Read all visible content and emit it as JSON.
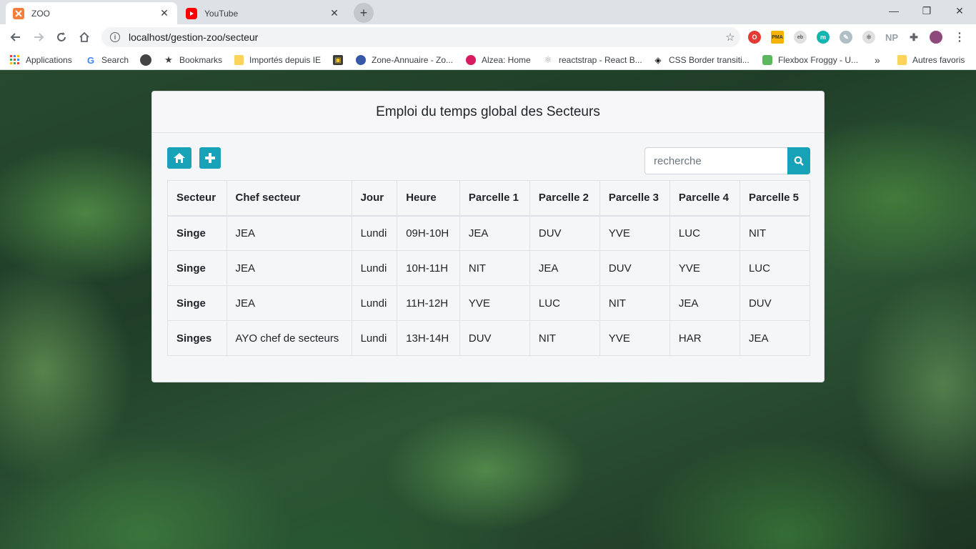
{
  "browser": {
    "tabs": [
      {
        "title": "ZOO",
        "active": true,
        "icon": "xampp-icon"
      },
      {
        "title": "YouTube",
        "active": false,
        "icon": "youtube-icon"
      }
    ],
    "url": "localhost/gestion-zoo/secteur",
    "bookmarks": [
      {
        "label": "Applications",
        "icon": "apps-grid-icon"
      },
      {
        "label": "Search",
        "icon": "google-icon"
      },
      {
        "label": "",
        "icon": "circle-icon"
      },
      {
        "label": "Bookmarks",
        "icon": "star-icon"
      },
      {
        "label": "Importés depuis IE",
        "icon": "folder-icon"
      },
      {
        "label": "",
        "icon": "game-icon"
      },
      {
        "label": "Zone-Annuaire - Zo...",
        "icon": "globe-icon"
      },
      {
        "label": "Alzea: Home",
        "icon": "alzea-icon"
      },
      {
        "label": "reactstrap - React B...",
        "icon": "react-icon"
      },
      {
        "label": "CSS Border transiti...",
        "icon": "codepen-icon"
      },
      {
        "label": "Flexbox Froggy - U...",
        "icon": "frog-icon"
      },
      {
        "label": "Autres favoris",
        "icon": "folder-icon"
      }
    ],
    "more_bookmarks": "»"
  },
  "page": {
    "title": "Emploi du temps global des Secteurs",
    "search": {
      "placeholder": "recherche"
    },
    "accent_color": "#17a2b8",
    "table": {
      "headers": [
        "Secteur",
        "Chef secteur",
        "Jour",
        "Heure",
        "Parcelle 1",
        "Parcelle 2",
        "Parcelle 3",
        "Parcelle 4",
        "Parcelle 5"
      ],
      "rows": [
        [
          "Singe",
          "JEA",
          "Lundi",
          "09H-10H",
          "JEA",
          "DUV",
          "YVE",
          "LUC",
          "NIT"
        ],
        [
          "Singe",
          "JEA",
          "Lundi",
          "10H-11H",
          "NIT",
          "JEA",
          "DUV",
          "YVE",
          "LUC"
        ],
        [
          "Singe",
          "JEA",
          "Lundi",
          "11H-12H",
          "YVE",
          "LUC",
          "NIT",
          "JEA",
          "DUV"
        ],
        [
          "Singes",
          "AYO chef de secteurs",
          "Lundi",
          "13H-14H",
          "DUV",
          "NIT",
          "YVE",
          "HAR",
          "JEA"
        ]
      ]
    }
  }
}
